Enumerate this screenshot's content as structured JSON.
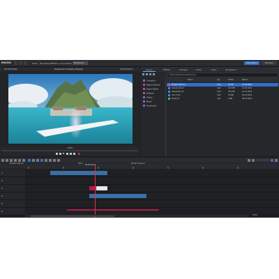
{
  "app": {
    "logo": "MAGIX",
    "menus": [
      "Datei",
      "Bearbeiten",
      "Effekte",
      "Ansicht",
      "Hilfe"
    ],
    "mode_badge": "Bearbeiten",
    "top_buttons": [
      "Exportieren",
      "Brennen"
    ]
  },
  "player": {
    "timecode_left": "00:00:03:08",
    "title": "Programm: Projekt_Tropical",
    "timecode_right": "00:00:30:07",
    "zoom_label": "100%"
  },
  "browser": {
    "tabs": [
      "Import",
      "Effekte",
      "Vorlagen",
      "Audio",
      "Store",
      "Gruppieren"
    ],
    "active_tab": "Import",
    "path": "C:\\Benutzer\\Dokumente\\Videos",
    "tree": [
      {
        "label": "Computer",
        "color": "#8a5cc9"
      },
      {
        "label": "Eigene Dateien",
        "color": "#c94a7a"
      },
      {
        "label": "Eigene Bilder",
        "color": "#c94a7a"
      },
      {
        "label": "Desktop",
        "color": "#8a5cc9"
      },
      {
        "label": "Videos",
        "color": "#8a5cc9"
      },
      {
        "label": "Musik",
        "color": "#8a5cc9"
      },
      {
        "label": "Downloads",
        "color": "#8a5cc9"
      }
    ],
    "columns": [
      "Name",
      "Typ",
      "Größe",
      "Datum"
    ],
    "files": [
      {
        "name": "Projekt_Tropical",
        "type": "mvp",
        "size": "12 KB",
        "date": "12.03.2021",
        "selected": true
      },
      {
        "name": "Urlaub_Strand",
        "type": "mp4",
        "size": "240 MB",
        "date": "11.03.2021",
        "selected": false
      },
      {
        "name": "Wasserfall_02",
        "type": "mp4",
        "size": "185 MB",
        "date": "10.03.2021",
        "selected": false
      },
      {
        "name": "Intro_Titel",
        "type": "mp4",
        "size": "32 MB",
        "date": "09.03.2021",
        "selected": false
      },
      {
        "name": "Musik_01",
        "type": "mp3",
        "size": "8 MB",
        "date": "08.03.2021",
        "selected": false
      }
    ]
  },
  "timeline": {
    "tab_left": "Projekt_Tropical",
    "tab_center": "Film 1",
    "tab_right": "Projekt_Tropical",
    "playhead_time": "00:00:03:08",
    "tracks": [
      "1",
      "2",
      "3",
      "4",
      "5",
      "6"
    ],
    "zoom_label": "100%"
  },
  "colors": {
    "accent": "#2c6fd1",
    "clip_blue": "#3b6fa8",
    "clip_red": "#b01e46",
    "background": "#1e1f22"
  }
}
